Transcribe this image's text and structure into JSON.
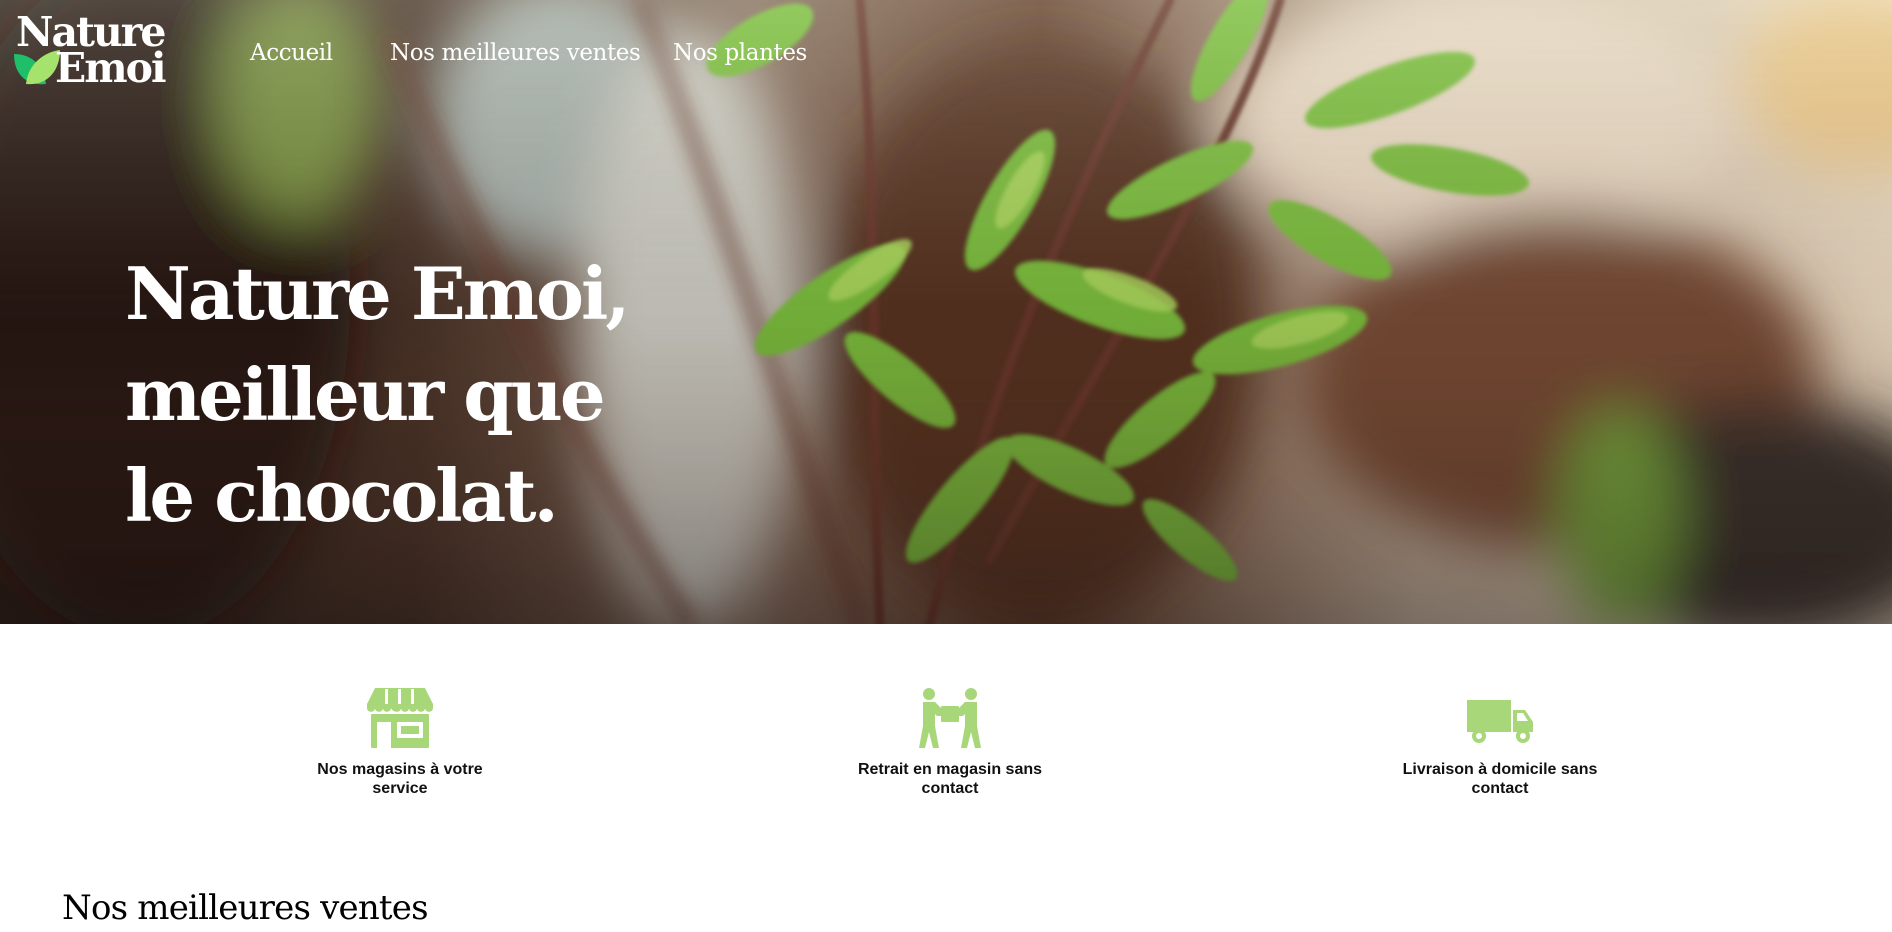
{
  "brand": {
    "line1": "Nature",
    "line2": "Emoi",
    "leaf_colors": [
      "#1fbf6a",
      "#a6e36c"
    ]
  },
  "nav": {
    "items": [
      {
        "label": "Accueil"
      },
      {
        "label": "Nos meilleures ventes"
      },
      {
        "label": "Nos plantes"
      }
    ]
  },
  "hero": {
    "title_lines": [
      "Nature Emoi,",
      "meilleur que",
      "le chocolat."
    ],
    "image": "blurred-green-plant-branches"
  },
  "features": [
    {
      "icon": "store-icon",
      "label": "Nos magasins à votre service"
    },
    {
      "icon": "carry-box-icon",
      "label": "Retrait en magasin sans contact"
    },
    {
      "icon": "delivery-truck-icon",
      "label": "Livraison à domicile sans contact"
    }
  ],
  "feature_icon_color": "#a8d77a",
  "sections": {
    "best_sellers_title": "Nos meilleures ventes"
  }
}
